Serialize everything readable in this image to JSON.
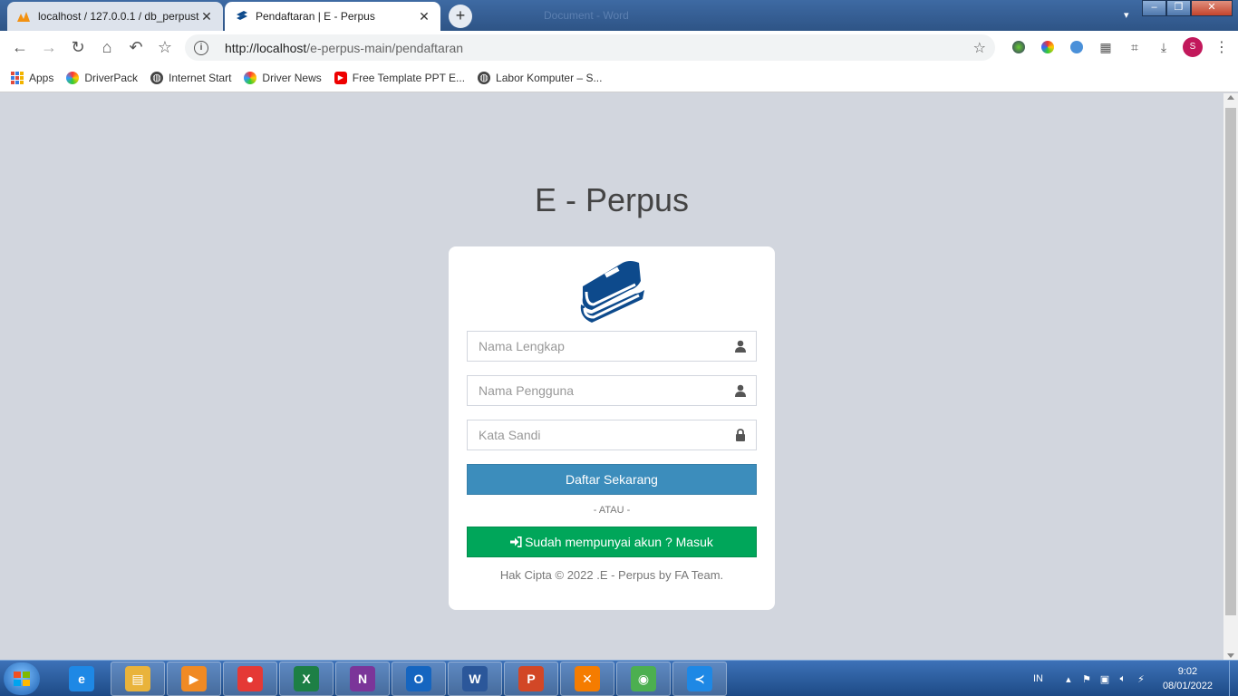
{
  "browser": {
    "window_title": "Document - Word",
    "tabs": [
      {
        "label": "localhost / 127.0.0.1 / db_perpust",
        "active": false,
        "favicon": "phpmyadmin-icon"
      },
      {
        "label": "Pendaftaran | E - Perpus",
        "active": true,
        "favicon": "book-icon"
      }
    ],
    "address": {
      "host": "http://localhost",
      "path": "/e-perpus-main/pendaftaran"
    },
    "profile_initial": "S",
    "bookmarks": [
      {
        "label": "Apps",
        "icon": "apps-grid-icon"
      },
      {
        "label": "DriverPack",
        "icon": "driverpack-icon"
      },
      {
        "label": "Internet Start",
        "icon": "globe-icon"
      },
      {
        "label": "Driver News",
        "icon": "driverpack-icon"
      },
      {
        "label": "Free Template PPT E...",
        "icon": "youtube-icon"
      },
      {
        "label": "Labor Komputer – S...",
        "icon": "globe-icon"
      }
    ]
  },
  "page": {
    "app_title": "E - Perpus",
    "logo": "book-stack-icon",
    "fields": {
      "fullname": {
        "placeholder": "Nama Lengkap",
        "icon": "user-icon"
      },
      "username": {
        "placeholder": "Nama Pengguna",
        "icon": "user-icon"
      },
      "password": {
        "placeholder": "Kata Sandi",
        "icon": "lock-icon"
      }
    },
    "register_button": "Daftar Sekarang",
    "separator": "- ATAU -",
    "login_button": "Sudah mempunyai akun ? Masuk",
    "copyright": "Hak Cipta © 2022 .E - Perpus by FA Team.",
    "colors": {
      "background": "#d2d6de",
      "primary": "#3c8dbc",
      "success": "#00a65a",
      "logo": "#0d4a8c"
    }
  },
  "taskbar": {
    "apps": [
      {
        "name": "internet-explorer-icon",
        "glyph": "e",
        "color": "#1e88e5"
      },
      {
        "name": "file-explorer-icon",
        "glyph": "▤",
        "color": "#e9b33b"
      },
      {
        "name": "media-player-icon",
        "glyph": "▶",
        "color": "#f08a24"
      },
      {
        "name": "recorder-icon",
        "glyph": "●",
        "color": "#e53935"
      },
      {
        "name": "excel-icon",
        "glyph": "X",
        "color": "#1d7f45"
      },
      {
        "name": "onenote-icon",
        "glyph": "N",
        "color": "#7b3599"
      },
      {
        "name": "outlook-icon",
        "glyph": "O",
        "color": "#1565c0"
      },
      {
        "name": "word-icon",
        "glyph": "W",
        "color": "#2b579a"
      },
      {
        "name": "powerpoint-icon",
        "glyph": "P",
        "color": "#d24726"
      },
      {
        "name": "xampp-icon",
        "glyph": "✕",
        "color": "#f57c00"
      },
      {
        "name": "chrome-icon",
        "glyph": "◉",
        "color": "#4caf50"
      },
      {
        "name": "vscode-icon",
        "glyph": "≺",
        "color": "#1e88e5"
      }
    ],
    "language": "IN",
    "time": "9:02",
    "date": "08/01/2022"
  }
}
